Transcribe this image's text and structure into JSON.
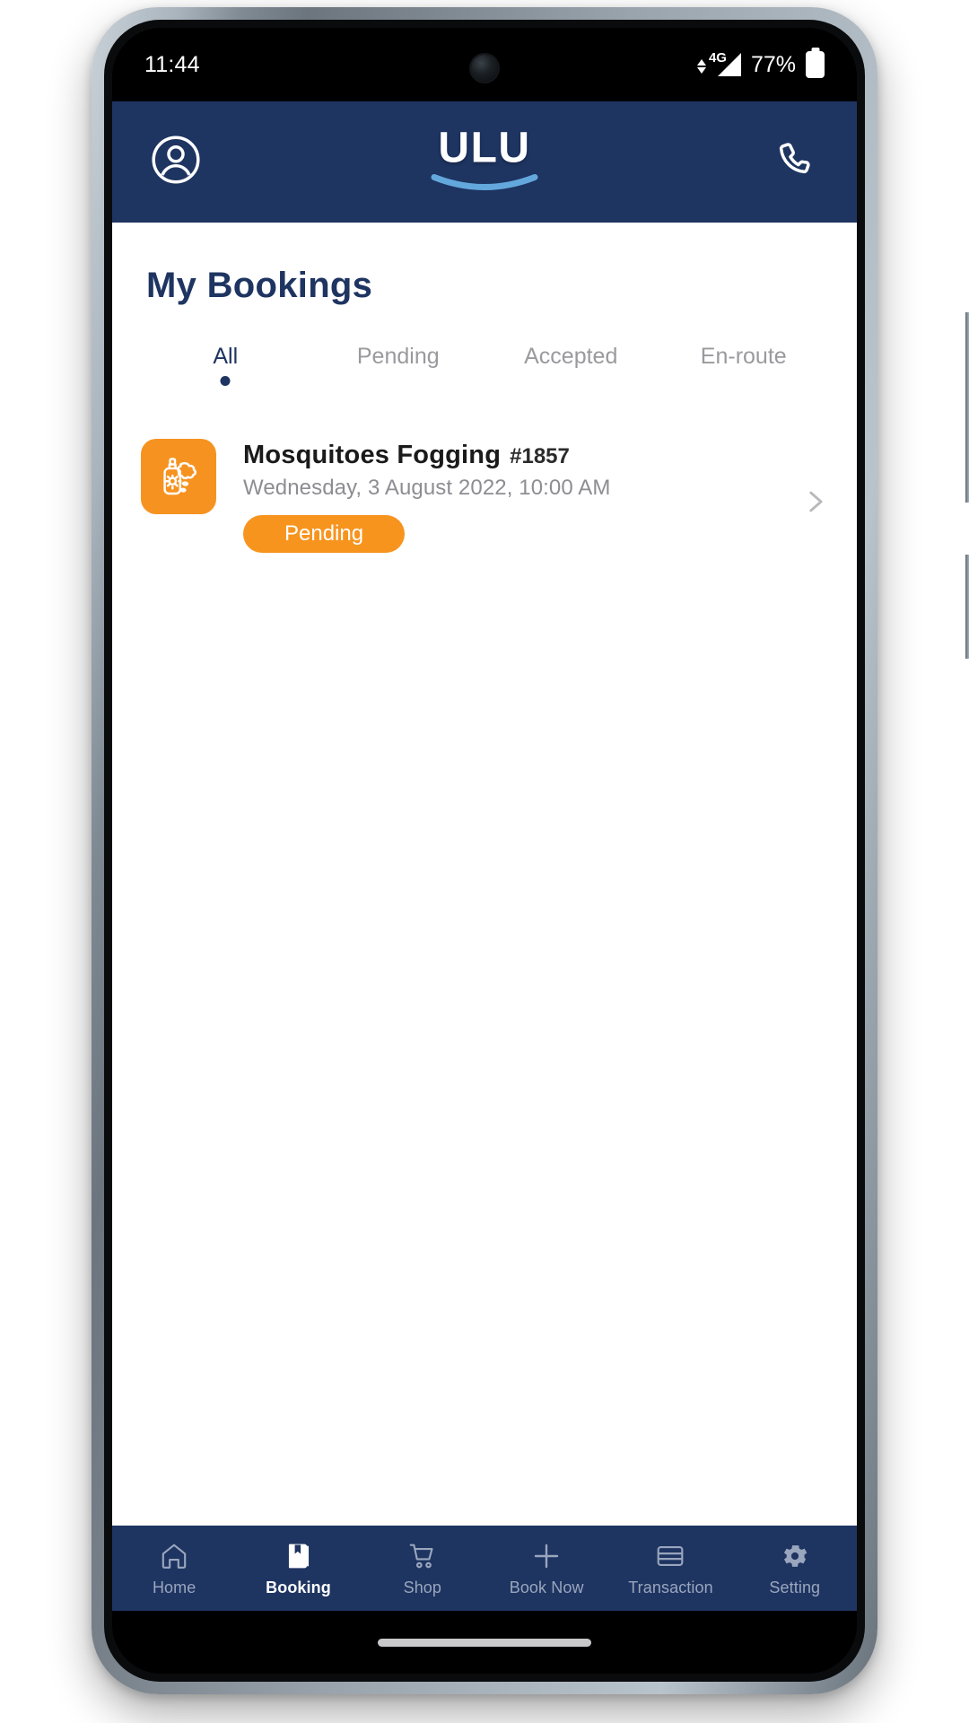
{
  "status_bar": {
    "time": "11:44",
    "network_label": "4G",
    "network_plus": "+",
    "battery_percent": "77%",
    "icons": {
      "camera": "front-camera-punch-hole",
      "data_transfer": "data-transfer-arrows-icon",
      "signal": "signal-strength-icon",
      "battery": "battery-icon"
    }
  },
  "header": {
    "logo_text": "ULU",
    "profile_icon": "user-profile-icon",
    "phone_icon": "phone-call-icon"
  },
  "page": {
    "title": "My Bookings"
  },
  "tabs": [
    {
      "label": "All",
      "active": true
    },
    {
      "label": "Pending",
      "active": false
    },
    {
      "label": "Accepted",
      "active": false
    },
    {
      "label": "En-route",
      "active": false
    }
  ],
  "bookings": [
    {
      "icon": "mosquito-fogging-spray-icon",
      "title": "Mosquitoes Fogging",
      "reference": "#1857",
      "datetime": "Wednesday, 3 August 2022, 10:00 AM",
      "status": "Pending",
      "chevron": "chevron-right-icon"
    }
  ],
  "bottom_nav": [
    {
      "label": "Home",
      "icon": "home-icon",
      "active": false
    },
    {
      "label": "Booking",
      "icon": "book-icon",
      "active": true
    },
    {
      "label": "Shop",
      "icon": "shopping-cart-icon",
      "active": false
    },
    {
      "label": "Book Now",
      "icon": "plus-icon",
      "active": false
    },
    {
      "label": "Transaction",
      "icon": "credit-card-icon",
      "active": false
    },
    {
      "label": "Setting",
      "icon": "gear-icon",
      "active": false
    }
  ],
  "colors": {
    "brand_navy": "#1e3461",
    "accent_orange": "#f7941e",
    "logo_smile_blue": "#63a8dd",
    "muted_gray": "#9a9a9e"
  }
}
